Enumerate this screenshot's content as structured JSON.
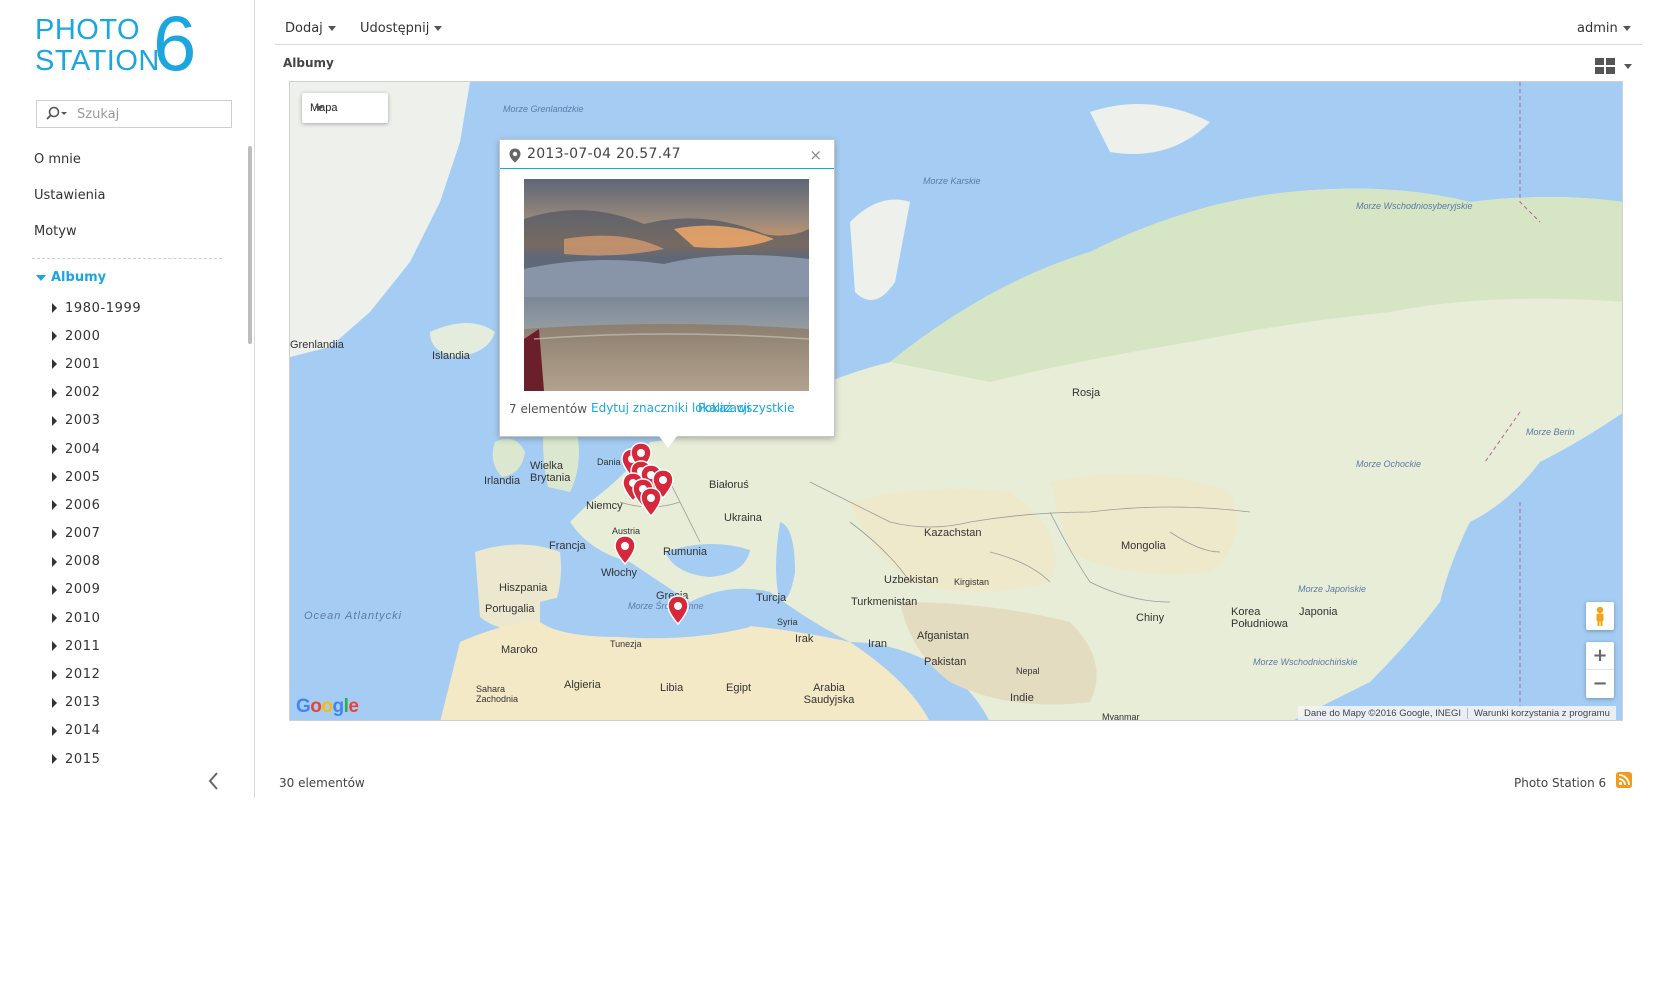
{
  "app": {
    "logo_line1": "PHOTO",
    "logo_line2": "STATION",
    "logo_version": "6",
    "accent_color": "#1aa7e0"
  },
  "search": {
    "placeholder": "Szukaj",
    "icon": "search-icon"
  },
  "sidebar": {
    "menu": [
      {
        "label": "O mnie"
      },
      {
        "label": "Ustawienia"
      },
      {
        "label": "Motyw"
      }
    ],
    "albums_label": "Albumy",
    "years": [
      "1980-1999",
      "2000",
      "2001",
      "2002",
      "2003",
      "2004",
      "2005",
      "2006",
      "2007",
      "2008",
      "2009",
      "2010",
      "2011",
      "2012",
      "2013",
      "2014",
      "2015"
    ]
  },
  "toolbar": {
    "add_label": "Dodaj",
    "share_label": "Udostępnij",
    "user_label": "admin"
  },
  "breadcrumb": "Albumy",
  "map": {
    "type_label": "Mapa",
    "labels": {
      "grenlandia": "Grenlandia",
      "islandia": "Islandia",
      "irlandia": "Irlandia",
      "wielka_brytania": "Wielka Brytania",
      "dania": "Dania",
      "niemcy": "Niemcy",
      "francja": "Francja",
      "austria": "Austria",
      "wlochy": "Włochy",
      "hiszpania": "Hiszpania",
      "portugalia": "Portugalia",
      "maroko": "Maroko",
      "algieria": "Algieria",
      "tunezja": "Tunezja",
      "libia": "Libia",
      "egipt": "Egipt",
      "sahara": "Sahara Zachodnia",
      "bialorus": "Białoruś",
      "ukraina": "Ukraina",
      "rumunia": "Rumunia",
      "grecja": "Grecja",
      "turcja": "Turcja",
      "syria": "Syria",
      "irak": "Irak",
      "iran": "Iran",
      "arabia": "Arabia Saudyjska",
      "rosja": "Rosja",
      "kazachstan": "Kazachstan",
      "uzbekistan": "Uzbekistan",
      "kirgistan": "Kirgistan",
      "turkmenistan": "Turkmenistan",
      "afganistan": "Afganistan",
      "pakistan": "Pakistan",
      "nepal": "Nepal",
      "indie": "Indie",
      "mongolia": "Mongolia",
      "chiny": "Chiny",
      "korea": "Korea Południowa",
      "japonia": "Japonia",
      "myanmar": "Myanmar"
    },
    "seas": {
      "grenlandzkie": "Morze Grenlandzkie",
      "karskie": "Morze Karskie",
      "wschodniosyberyjskie": "Morze Wschodniosyberyjskie",
      "ochockie": "Morze Ochockie",
      "japonskie": "Morze Japońskie",
      "wschodniochinskie": "Morze Wschodniochińskie",
      "beringa": "Morze Berin",
      "srodziemne": "Morze Śródziemne",
      "atlantycki": "Ocean Atlantycki"
    },
    "zoom_in": "+",
    "zoom_out": "−",
    "google_logo": "Google",
    "attribution": "Dane do Mapy ©2016 Google, INEGI",
    "terms": "Warunki korzystania z programu",
    "popup": {
      "title": "2013-07-04 20.57.47",
      "close": "×",
      "count": "7 elementów",
      "edit_link": "Edytuj znaczniki lokalizacji",
      "show_all_link": "Pokaż wszystkie"
    }
  },
  "footer": {
    "count": "30 elementów",
    "brand": "Photo Station 6"
  }
}
